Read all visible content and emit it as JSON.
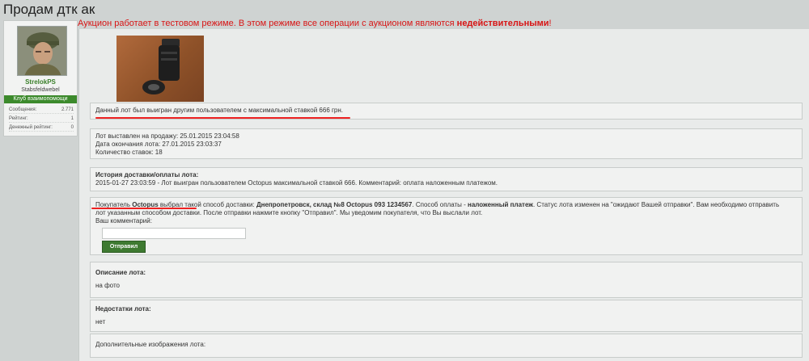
{
  "page": {
    "title": "Продам дтк ак"
  },
  "notice": {
    "text": "Аукцион работает в тестовом режиме. В этом режиме все операции с аукционом являются ",
    "bold": "недействительными",
    "suffix": "!"
  },
  "user": {
    "name": "StrelokPS",
    "rank": "Stabsfeldwebel",
    "club": "Клуб взаимопомощи",
    "stats": [
      {
        "label": "Сообщения:",
        "value": "2.771"
      },
      {
        "label": "Рейтинг:",
        "value": "1"
      },
      {
        "label": "Денежный рейтинг:",
        "value": "0"
      }
    ]
  },
  "lot": {
    "winner_notice": "Данный лот был выигран другим пользователем с максимальной ставкой 666 грн.",
    "info": {
      "listed": "Лот выставлен на продажу: 25.01.2015 23:04:58",
      "ends": "Дата окончания лота: 27.01.2015 23:03:37",
      "bids": "Количество ставок: 18"
    },
    "history": {
      "title": "История доставки/оплаты лота:",
      "entry": "2015-01-27 23:03:59 - Лот выигран пользователем Octopus максимальной ставкой 666. Комментарий: оплата наложенным платежом."
    },
    "delivery": {
      "p1": "Покупатель ",
      "buyer": "Octopus",
      "p2": " выбрал такой способ доставки: ",
      "method": "Днепропетровск, склад №8 Octopus 093 1234567",
      "p3": ". Способ оплаты - ",
      "payment": "наложенный платеж",
      "p4": ". Статус лота изменен на \"ожидают Вашей отправки\". Вам необходимо отправить",
      "line2": "лот указанным способом доставки. После отправки нажмите кнопку \"Отправил\". Мы уведомим покупателя, что Вы выслали лот.",
      "comment_label": "Ваш комментарий:",
      "send_label": "Отправил"
    },
    "description": {
      "title": "Описание лота:",
      "text": "на фото"
    },
    "flaws": {
      "title": "Недостатки лота:",
      "text": "нет"
    },
    "extra_images": {
      "title": "Дополнительные изображения лота:"
    }
  }
}
